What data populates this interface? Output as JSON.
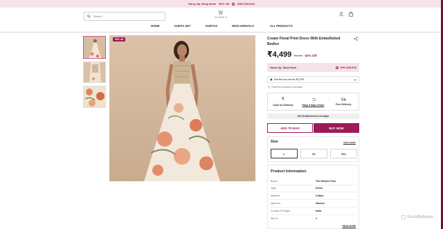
{
  "promo": {
    "text": "Hurry Up, Shop Now!",
    "discount": "50% Off",
    "timer": "00H:21M:31S"
  },
  "header": {
    "search_placeholder": "Search",
    "logo_mark": "W",
    "logo_text": "WOMEN'S"
  },
  "nav": {
    "items": [
      "HOME",
      "KURTA SET",
      "KURTAS",
      "NEW ARRIVALS",
      "ALL PRODUCTS"
    ]
  },
  "gallery": {
    "off_badge": "50% off"
  },
  "product": {
    "title": "Cream Floral Print Dress With Embellished Bodice",
    "price": "₹4,499",
    "mrp": "₹8,999",
    "discount": "50% Off"
  },
  "hurry": {
    "label": "Hurry Up, Shop Now!",
    "timer": "00H:21M:31S"
  },
  "offer": {
    "text": "Get this as low as ₹3,799"
  },
  "taxes": {
    "text": "Final Price Inclusive of all taxes"
  },
  "features": [
    {
      "icon": "rupee-icon",
      "label": "Cash on Delivery"
    },
    {
      "icon": "return-icon",
      "label": "Easy 5 days return"
    },
    {
      "icon": "truck-icon",
      "label": "Free Delivery"
    }
  ],
  "delivery": {
    "text": "Get it delivered in 4-9 days"
  },
  "actions": {
    "add_to_bag": "ADD TO BAG",
    "buy_now": "BUY NOW"
  },
  "size": {
    "title": "Size",
    "chart_label": "SIZE CHART",
    "options": [
      "L",
      "XL",
      "2XL"
    ],
    "selected": "L"
  },
  "info": {
    "title": "Product Information",
    "rows": [
      {
        "key": "Brand",
        "value": "The Women Plus"
      },
      {
        "key": "Type",
        "value": "Dress"
      },
      {
        "key": "Material",
        "value": "Cotton"
      },
      {
        "key": "Ideal For",
        "value": "Women"
      },
      {
        "key": "Country Of Origin",
        "value": "India"
      },
      {
        "key": "Set Of",
        "value": "1"
      }
    ],
    "read_more": "READ MORE"
  },
  "watermark": "ScanMalware",
  "colors": {
    "brand": "#9c1a57",
    "promo_bg": "#f6e3ea",
    "accent_dark": "#6b0f3a"
  }
}
